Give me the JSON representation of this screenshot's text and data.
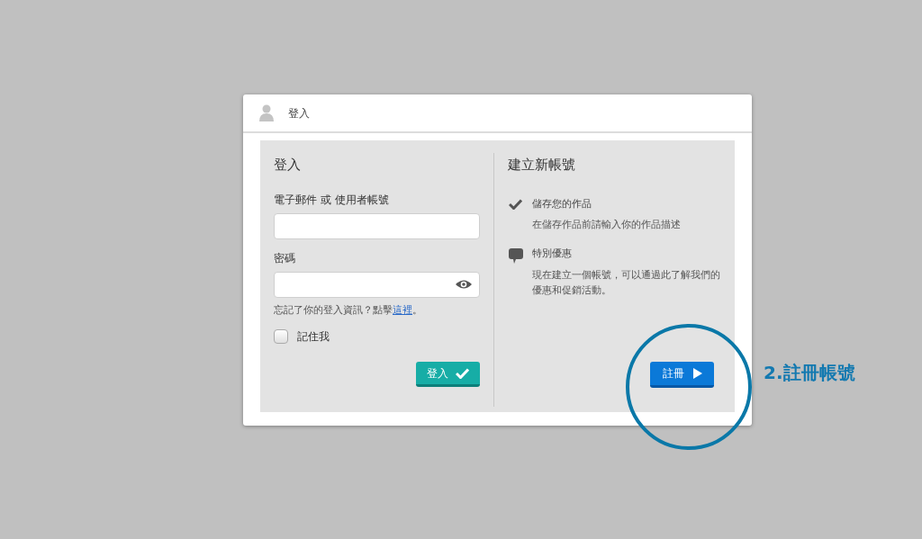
{
  "dialog": {
    "title": "登入"
  },
  "login": {
    "heading": "登入",
    "fields": [
      {
        "label": "電子郵件 或 使用者帳號",
        "kind": "text"
      },
      {
        "label": "密碼",
        "kind": "password"
      }
    ],
    "forgot": {
      "prefix": "忘記了你的登入資訊？點擊",
      "link": "這裡",
      "suffix": "。"
    },
    "remember": {
      "label": "記住我",
      "checked": false
    },
    "button": "登入"
  },
  "signup": {
    "heading": "建立新帳號",
    "features": [
      {
        "kind": "check",
        "title": "儲存您的作品",
        "text": "在儲存作品前請輸入你的作品描述"
      },
      {
        "kind": "chat",
        "title": "特別優惠",
        "text": "現在建立一個帳號，可以通過此了解我們的優惠和促銷活動。"
      }
    ],
    "button": "註冊"
  },
  "annotation": {
    "label": "2.註冊帳號"
  }
}
